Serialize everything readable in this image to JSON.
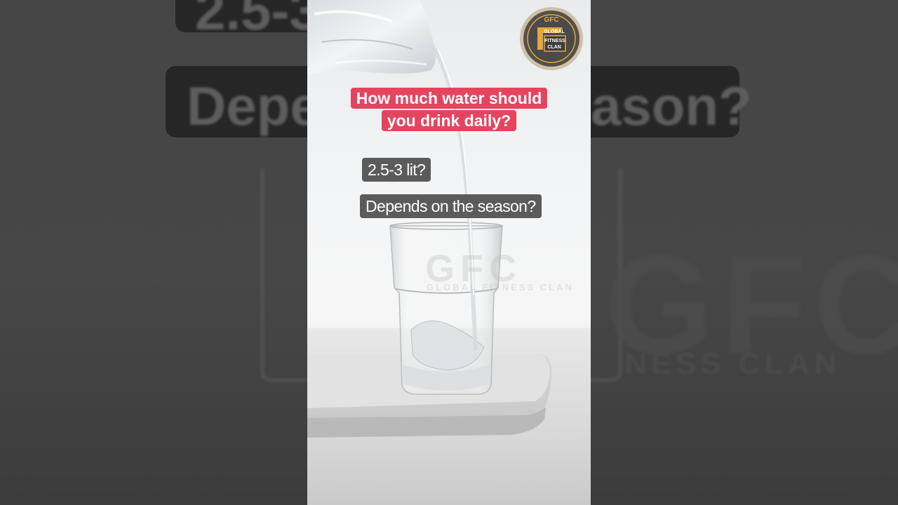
{
  "caption": {
    "question_line1": "How much water should",
    "question_line2": "you drink daily?",
    "answer1": "2.5-3 lit?",
    "answer2": "Depends on the season?"
  },
  "ghost": {
    "top_text": "2.5-3",
    "left_text": "Depe",
    "right_text": "ason?",
    "gfc": "GFC",
    "gfc_sub": "NESS CLAN"
  },
  "watermark": {
    "main": "GFC",
    "sub": "GLOBAL FITNESS CLAN"
  },
  "logo": {
    "top": "GFC",
    "line1": "GLOBAL",
    "line2": "FITNESS",
    "line3": "CLAN",
    "colors": {
      "gold": "#e2a83a",
      "dark": "#3d3d3d",
      "ring": "#c8b89a"
    }
  },
  "colors": {
    "accent": "#e5445f",
    "chip": "#5b5b5b"
  }
}
